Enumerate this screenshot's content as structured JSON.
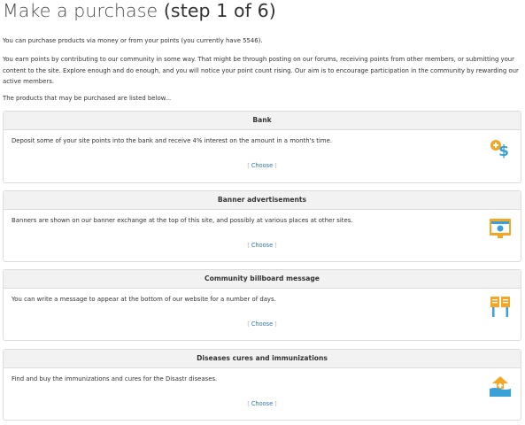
{
  "header": {
    "title": "Make a purchase",
    "step": "(step 1 of 6)"
  },
  "intro": {
    "p1": "You can purchase products via money or from your points (you currently have 5546).",
    "p2": "You earn points by contributing to our community in some way. That might be through posting on our forums, receiving points from other members, or submitting your content to the site. Explore enough and do enough, and you will notice your point count rising. Our aim is to encourage participation in the community by rewarding our active members.",
    "p3": "The products that may be purchased are listed below..."
  },
  "products": [
    {
      "name": "Bank",
      "description": "Deposit some of your site points into the bank and receive 4% interest on the amount in a month's time.",
      "choose_label": "Choose",
      "icon": "bank-icon"
    },
    {
      "name": "Banner advertisements",
      "description": "Banners are shown on our banner exchange at the top of this site, and possibly at various places at other sites.",
      "choose_label": "Choose",
      "icon": "banner-icon"
    },
    {
      "name": "Community billboard message",
      "description": "You can write a message to appear at the bottom of our website for a number of days.",
      "choose_label": "Choose",
      "icon": "billboard-icon"
    },
    {
      "name": "Diseases cures and immunizations",
      "description": "Find and buy the immunizations and cures for the Disastr diseases.",
      "choose_label": "Choose",
      "icon": "disease-cure-icon"
    }
  ],
  "colors": {
    "link": "#2b72b7",
    "box_header_bg": "#f2f2f2",
    "border": "#dcdcdc",
    "icon_orange": "#f5a623",
    "icon_blue": "#3aa0d9"
  }
}
